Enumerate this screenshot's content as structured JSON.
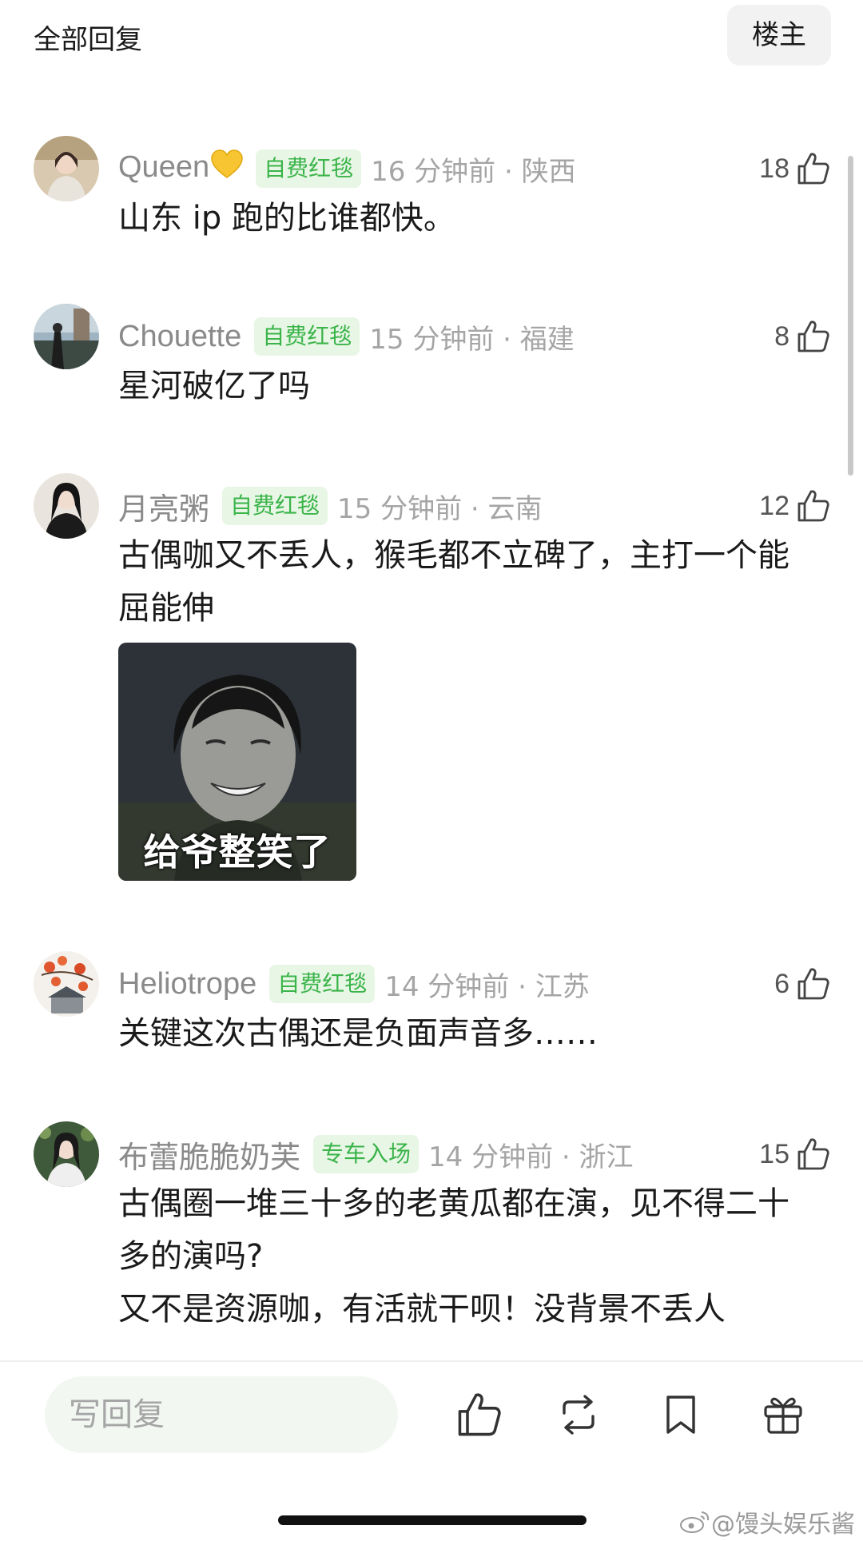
{
  "header": {
    "title": "全部回复",
    "op_button": "楼主"
  },
  "comments": [
    {
      "username": "Queen",
      "username_emoji": "yellow-heart",
      "badge": "自费红毯",
      "time_location": "16 分钟前 · 陕西",
      "likes": "18",
      "content": "山东 ip 跑的比谁都快。"
    },
    {
      "username": "Chouette",
      "badge": "自费红毯",
      "time_location": "15 分钟前 · 福建",
      "likes": "8",
      "content": "星河破亿了吗"
    },
    {
      "username": "月亮粥",
      "badge": "自费红毯",
      "time_location": "15 分钟前 · 云南",
      "likes": "12",
      "content": "古偶咖又不丢人，猴毛都不立碑了，主打一个能屈能伸",
      "sticker_caption": "给爷整笑了"
    },
    {
      "username": "Heliotrope",
      "badge": "自费红毯",
      "time_location": "14 分钟前 · 江苏",
      "likes": "6",
      "content": "关键这次古偶还是负面声音多……"
    },
    {
      "username": "布蕾脆脆奶芙",
      "badge": "专车入场",
      "time_location": "14 分钟前 · 浙江",
      "likes": "15",
      "content_lines": [
        "古偶圈一堆三十多的老黄瓜都在演，见不得二十多的演吗?",
        "又不是资源咖，有活就干呗！没背景不丢人"
      ]
    }
  ],
  "bottom_bar": {
    "reply_placeholder": "写回复",
    "icons": [
      "thumbs-up-icon",
      "repost-icon",
      "bookmark-icon",
      "gift-icon"
    ]
  },
  "watermark": "@馒头娱乐酱",
  "colors": {
    "badge_bg": "#e8f6e5",
    "badge_text": "#3bb44a",
    "meta_gray": "#a5a5a5",
    "username_gray": "#8a8a8a"
  }
}
